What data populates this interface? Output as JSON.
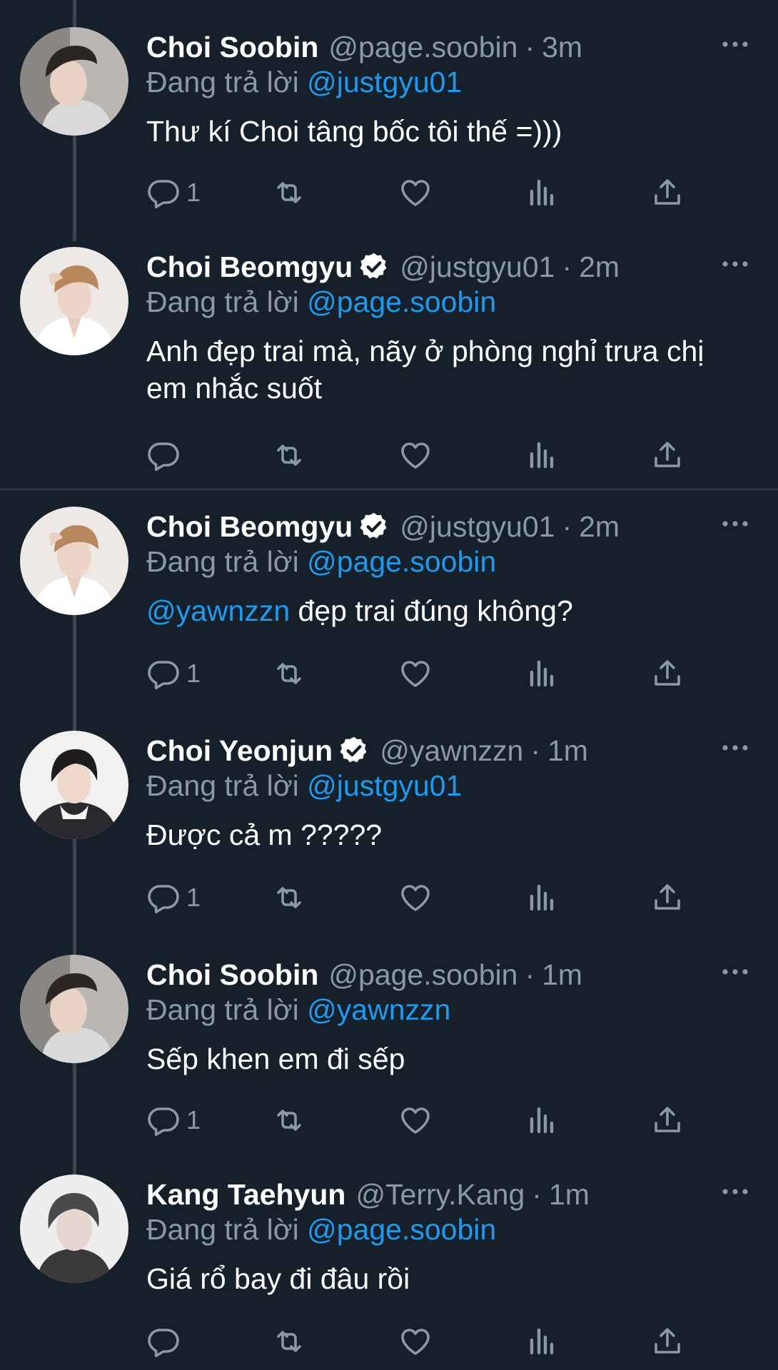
{
  "tweets": [
    {
      "name": "Choi Soobin",
      "verified": false,
      "handle": "@page.soobin",
      "time": "3m",
      "reply_prefix": "Đang trả lời",
      "reply_to": "@justgyu01",
      "mention": "",
      "text": "Thư kí Choi tâng bốc tôi thế =)))",
      "reply_count": "1"
    },
    {
      "name": "Choi Beomgyu",
      "verified": true,
      "handle": "@justgyu01",
      "time": "2m",
      "reply_prefix": "Đang trả lời",
      "reply_to": "@page.soobin",
      "mention": "",
      "text": "Anh đẹp trai mà, nãy ở phòng nghỉ trưa chị em nhắc suốt",
      "reply_count": ""
    },
    {
      "name": "Choi Beomgyu",
      "verified": true,
      "handle": "@justgyu01",
      "time": "2m",
      "reply_prefix": "Đang trả lời",
      "reply_to": "@page.soobin",
      "mention": "@yawnzzn",
      "text": " đẹp trai đúng không?",
      "reply_count": "1"
    },
    {
      "name": "Choi Yeonjun",
      "verified": true,
      "handle": "@yawnzzn",
      "time": "1m",
      "reply_prefix": "Đang trả lời",
      "reply_to": "@justgyu01",
      "mention": "",
      "text": "Được cả m ?????",
      "reply_count": "1"
    },
    {
      "name": "Choi Soobin",
      "verified": false,
      "handle": "@page.soobin",
      "time": "1m",
      "reply_prefix": "Đang trả lời",
      "reply_to": "@yawnzzn",
      "mention": "",
      "text": "Sếp khen em đi sếp",
      "reply_count": "1"
    },
    {
      "name": "Kang Taehyun",
      "verified": false,
      "handle": "@Terry.Kang",
      "time": "1m",
      "reply_prefix": "Đang trả lời",
      "reply_to": "@page.soobin",
      "mention": "",
      "text": "Giá rổ bay đi đâu rồi",
      "reply_count": ""
    }
  ],
  "separator": "·",
  "icons": {
    "reply": "reply-icon",
    "retweet": "retweet-icon",
    "like": "heart-icon",
    "views": "analytics-icon",
    "share": "share-icon",
    "more": "more-dots-icon",
    "verified": "verified-badge-icon"
  },
  "colors": {
    "background": "#16202b",
    "text": "#ffffff",
    "muted": "#8b98a5",
    "link": "#1d9bf0"
  }
}
